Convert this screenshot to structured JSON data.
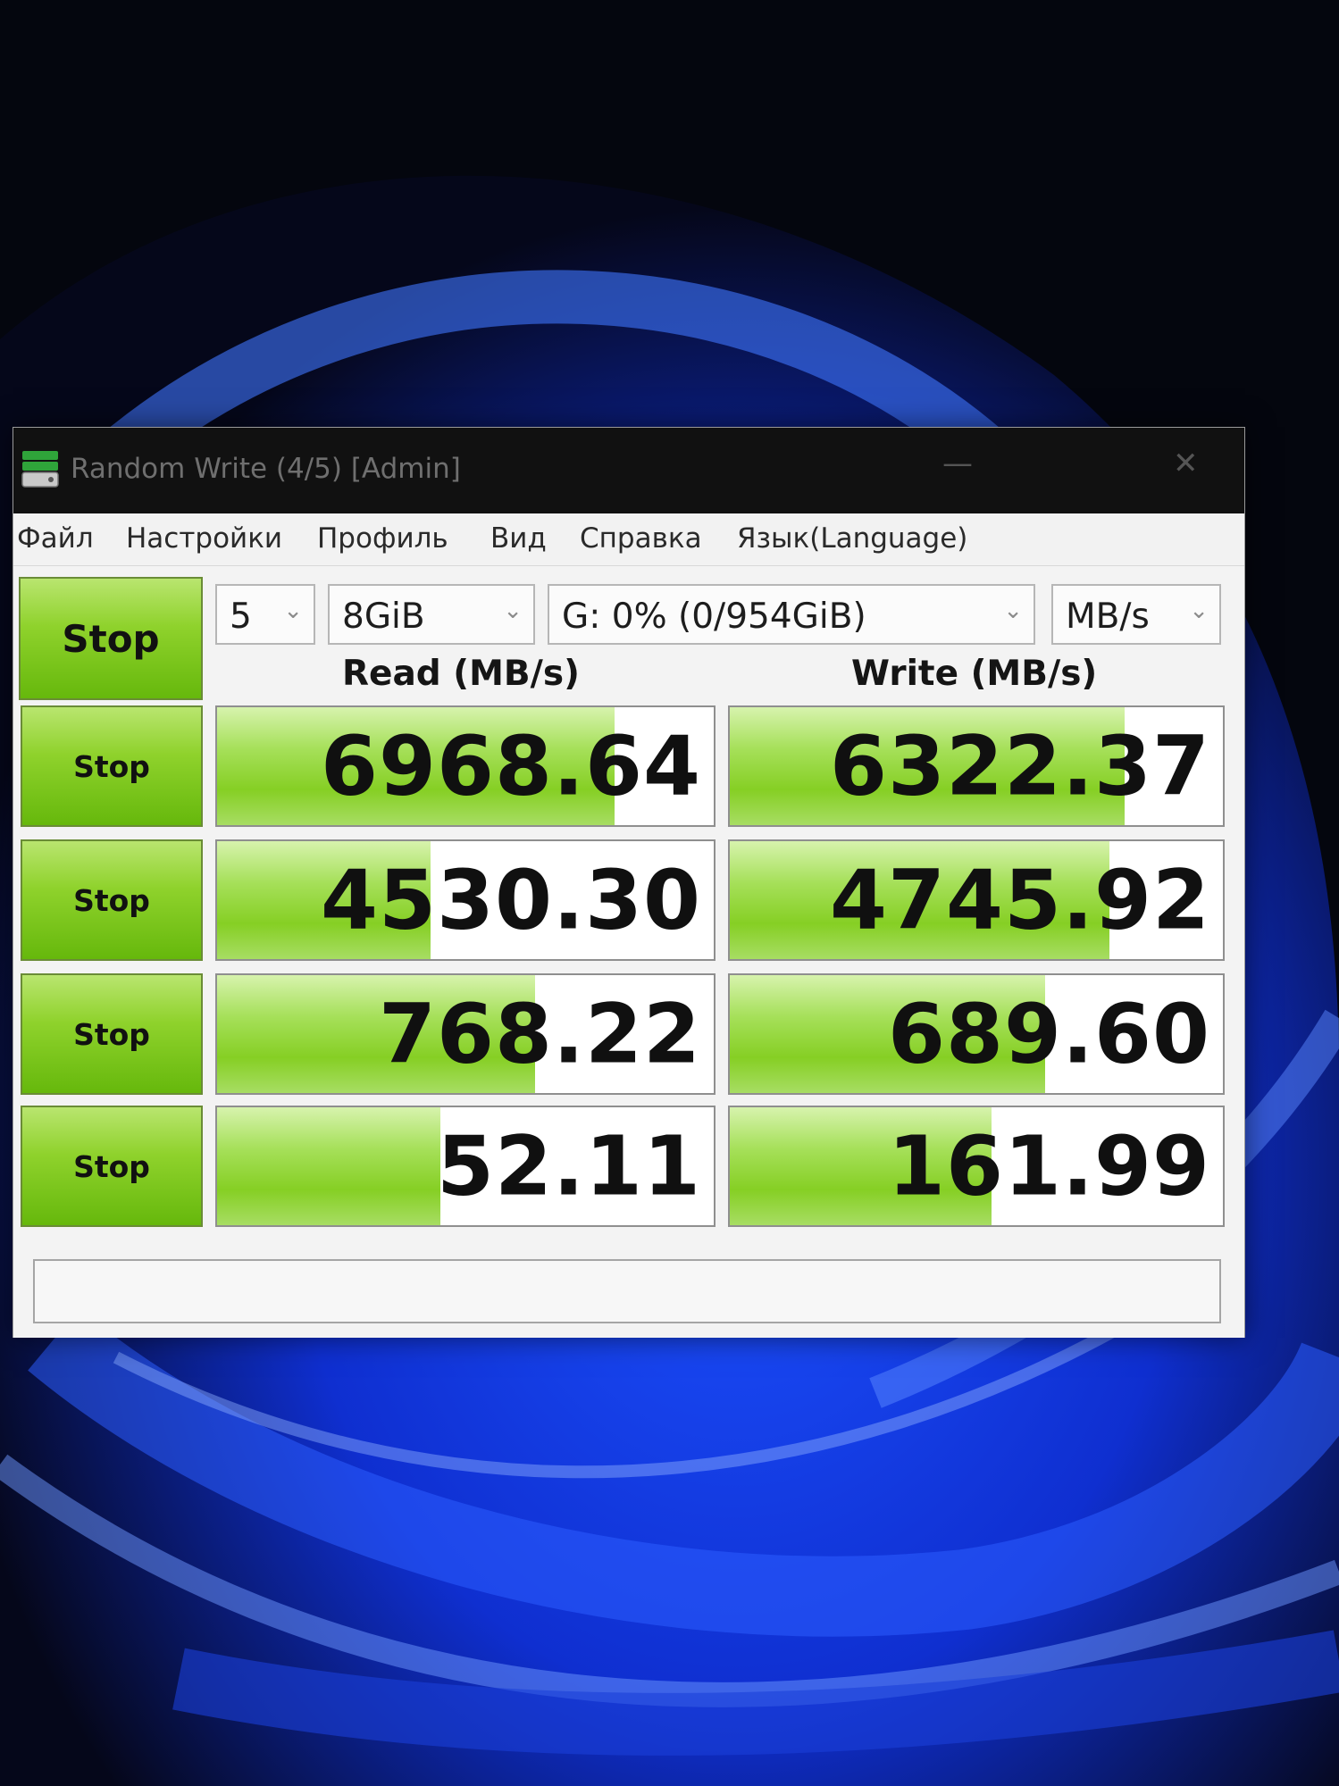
{
  "window": {
    "title": "Random Write (4/5) [Admin]",
    "minimize_glyph": "—",
    "close_glyph": "✕"
  },
  "menu": [
    "Файл",
    "Настройки",
    "Профиль",
    "Вид",
    "Справка",
    "Язык(Language)"
  ],
  "controls": {
    "all_button": "Stop",
    "count": "5",
    "size": "8GiB",
    "drive": "G: 0% (0/954GiB)",
    "unit": "MB/s"
  },
  "columns": {
    "read": "Read (MB/s)",
    "write": "Write (MB/s)"
  },
  "rows": [
    {
      "button": "Stop",
      "read": "6968.64",
      "write": "6322.37",
      "read_fill": 0.8,
      "write_fill": 0.8
    },
    {
      "button": "Stop",
      "read": "4530.30",
      "write": "4745.92",
      "read_fill": 0.43,
      "write_fill": 0.77
    },
    {
      "button": "Stop",
      "read": "768.22",
      "write": "689.60",
      "read_fill": 0.64,
      "write_fill": 0.64
    },
    {
      "button": "Stop",
      "read": "52.11",
      "write": "161.99",
      "read_fill": 0.45,
      "write_fill": 0.53
    }
  ],
  "status_text": "",
  "colors": {
    "bar_green": "#86cf24",
    "button_green": "#8fd22c"
  }
}
